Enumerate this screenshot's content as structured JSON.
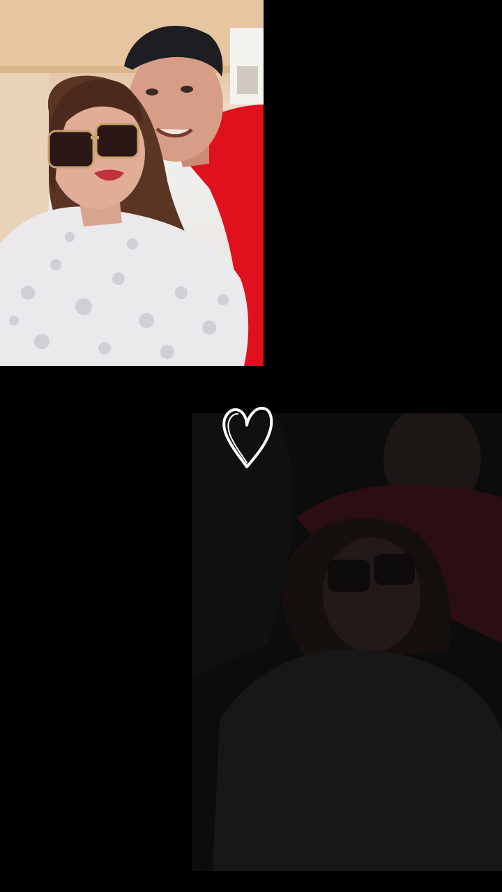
{
  "story": {
    "background_color": "#000000",
    "photos": [
      {
        "name": "couple-selfie-bright",
        "accent": "#e0101c"
      },
      {
        "name": "couple-selfie-dark",
        "accent": "#3a1014"
      }
    ],
    "sticker_icon": "heart-outline-icon"
  }
}
